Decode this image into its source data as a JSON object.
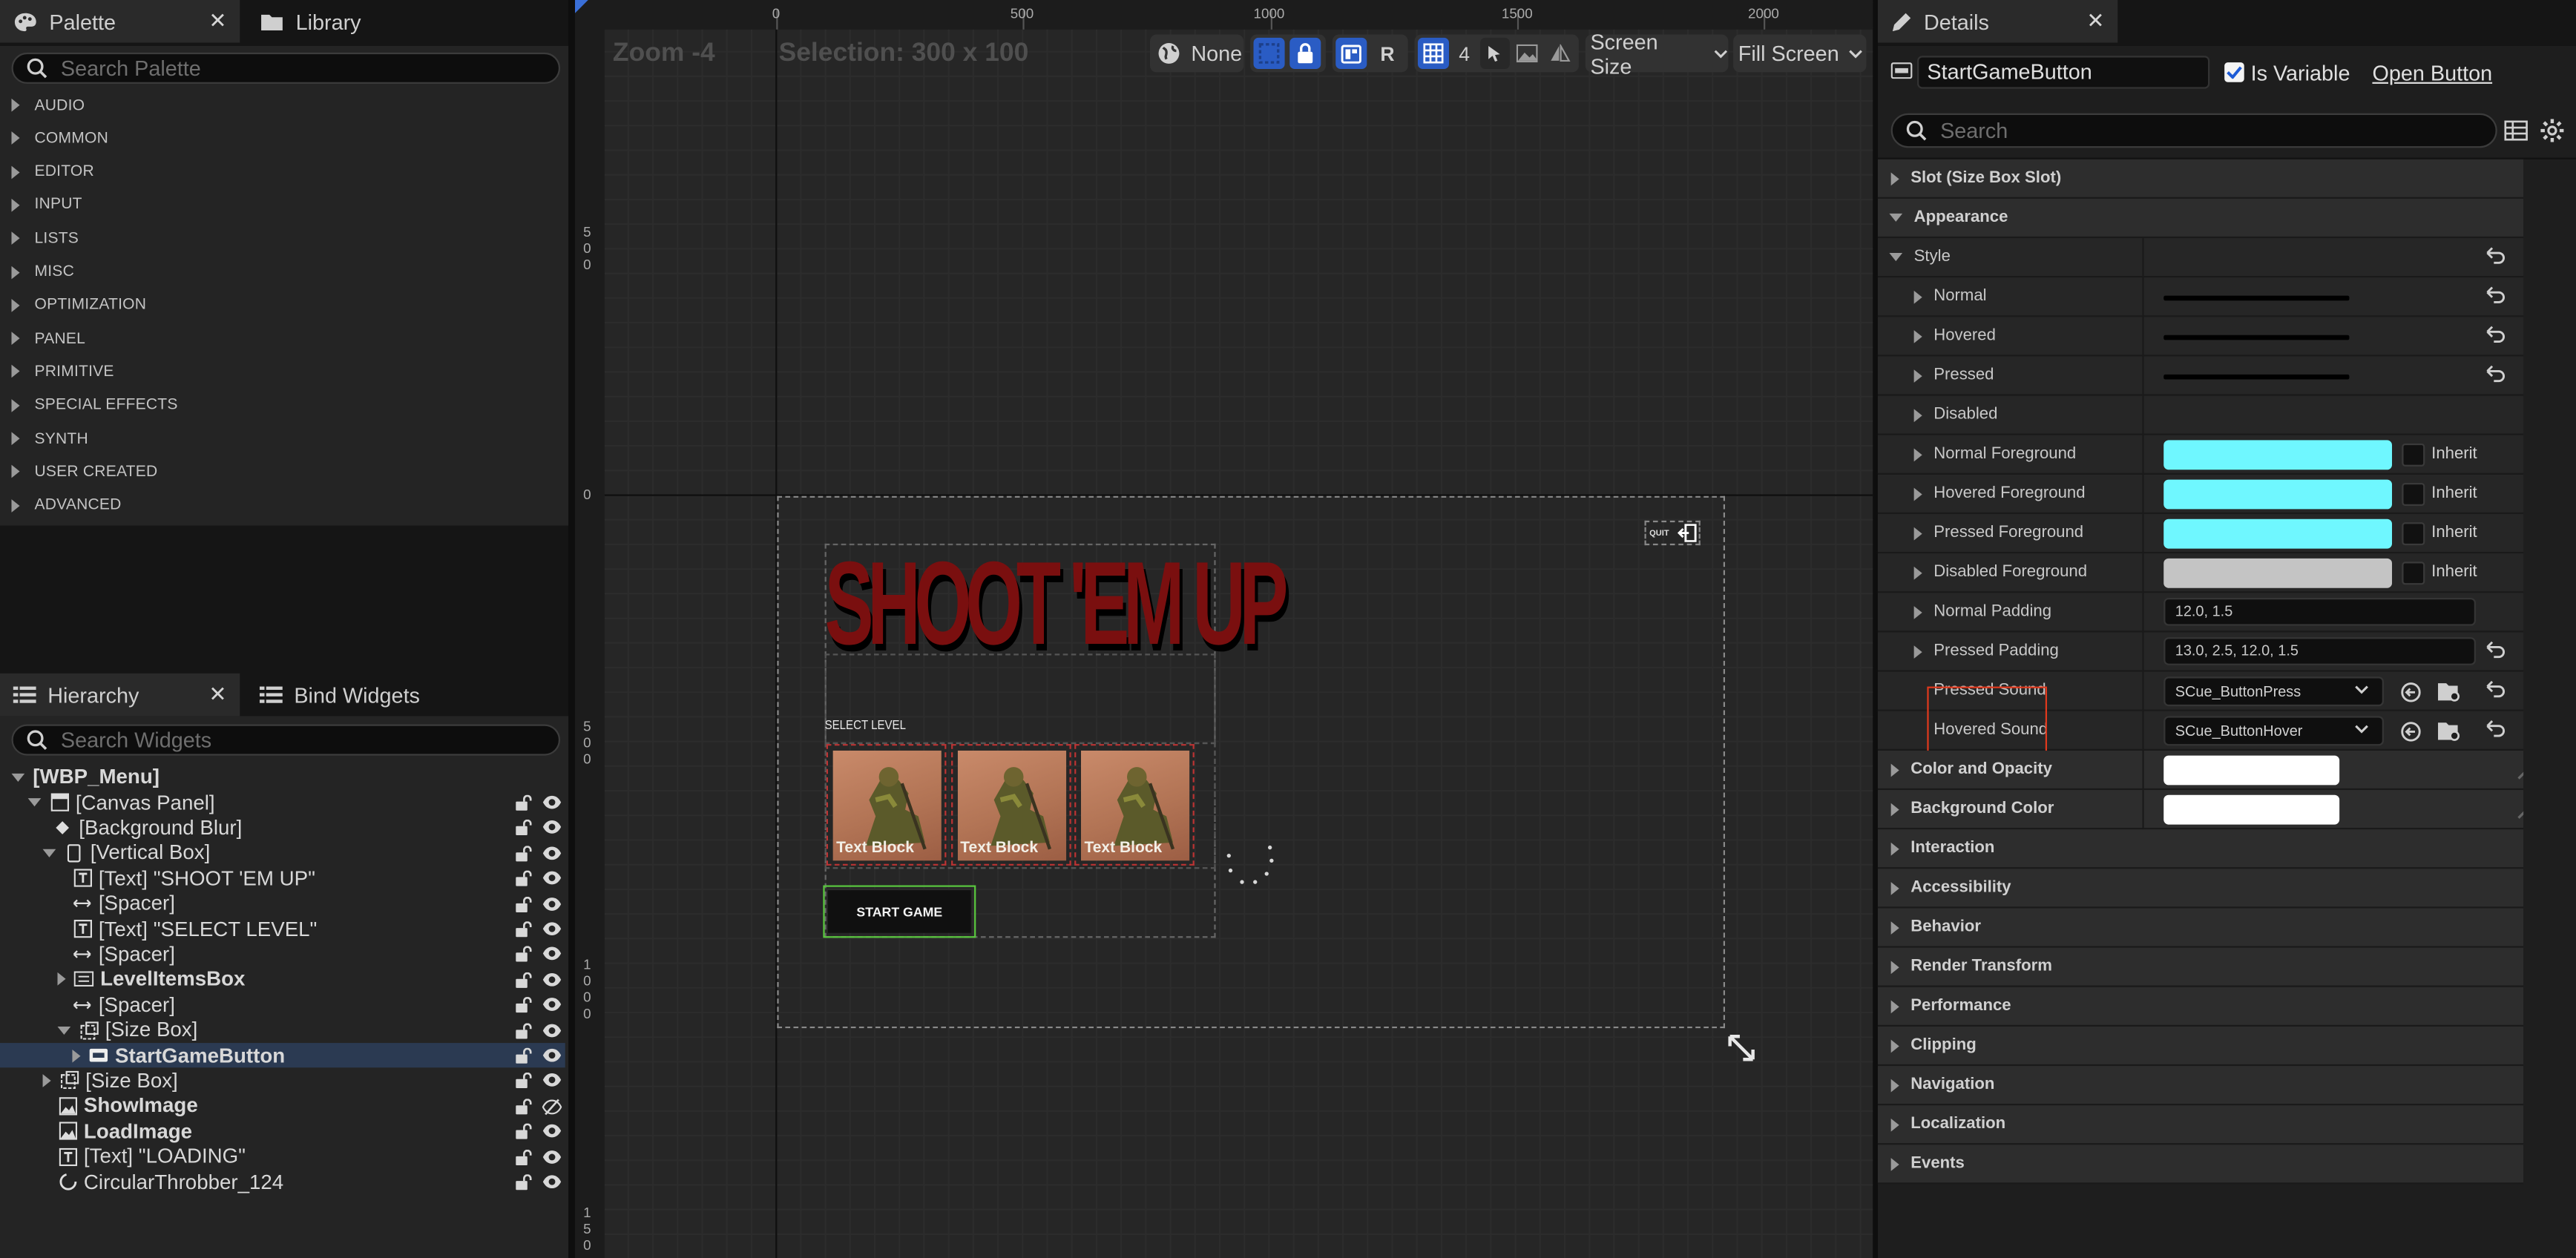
{
  "palette": {
    "tab_label": "Palette",
    "library_tab": "Library",
    "search_placeholder": "Search Palette",
    "categories": [
      "AUDIO",
      "COMMON",
      "EDITOR",
      "INPUT",
      "LISTS",
      "MISC",
      "OPTIMIZATION",
      "PANEL",
      "PRIMITIVE",
      "SPECIAL EFFECTS",
      "SYNTH",
      "USER CREATED",
      "ADVANCED"
    ]
  },
  "hierarchy": {
    "tab_label": "Hierarchy",
    "bind_tab": "Bind Widgets",
    "search_placeholder": "Search Widgets",
    "rows": [
      "[WBP_Menu]",
      "[Canvas Panel]",
      "[Background Blur]",
      "[Vertical Box]",
      "[Text] \"SHOOT 'EM UP\"",
      "[Spacer]",
      "[Text] \"SELECT LEVEL\"",
      "[Spacer]",
      "LevelItemsBox",
      "[Spacer]",
      "[Size Box]",
      "StartGameButton",
      "[Size Box]",
      "ShowImage",
      "LoadImage",
      "[Text] \"LOADING\"",
      "CircularThrobber_124"
    ]
  },
  "viewport": {
    "zoom": "Zoom -4",
    "selection": "Selection: 300 x 100",
    "toolbar": {
      "localize": "None",
      "respect": "R",
      "grid_size": "4",
      "screen_size": "Screen Size",
      "fill_screen": "Fill Screen"
    },
    "ruler_top": [
      "0",
      "500",
      "1000",
      "1500",
      "2000"
    ],
    "ruler_left": [
      "500",
      "0",
      "500",
      "1000",
      "150"
    ],
    "canvas": {
      "title": "SHOOT 'EM UP",
      "select_level": "SELECT LEVEL",
      "level_text": [
        "Text Block",
        "Text Block",
        "Text Block"
      ],
      "start_button": "START GAME",
      "quit_label": "QUIT"
    }
  },
  "details": {
    "tab_label": "Details",
    "widget_name": "StartGameButton",
    "is_variable": "Is Variable",
    "open_button": "Open Button",
    "search_placeholder": "Search",
    "rows": {
      "slot": "Slot (Size Box Slot)",
      "appearance": "Appearance",
      "style": "Style",
      "normal": "Normal",
      "hovered": "Hovered",
      "pressed": "Pressed",
      "disabled": "Disabled",
      "normal_fg": "Normal Foreground",
      "hovered_fg": "Hovered Foreground",
      "pressed_fg": "Pressed Foreground",
      "disabled_fg": "Disabled Foreground",
      "inherit": "Inherit",
      "normal_padding": "Normal Padding",
      "normal_padding_val": "12.0, 1.5",
      "pressed_padding": "Pressed Padding",
      "pressed_padding_val": "13.0, 2.5, 12.0, 1.5",
      "pressed_sound": "Pressed Sound",
      "pressed_sound_val": "SCue_ButtonPress",
      "hovered_sound": "Hovered Sound",
      "hovered_sound_val": "SCue_ButtonHover",
      "color_opacity": "Color and Opacity",
      "bg_color": "Background Color",
      "interaction": "Interaction",
      "accessibility": "Accessibility",
      "behavior": "Behavior",
      "render_transform": "Render Transform",
      "performance": "Performance",
      "clipping": "Clipping",
      "navigation": "Navigation",
      "localization": "Localization",
      "events": "Events"
    },
    "colors": {
      "foreground": "#6ff7ff",
      "disabled_fg": "#c4c4c4",
      "white": "#ffffff",
      "highlight": "#e0391d"
    }
  }
}
